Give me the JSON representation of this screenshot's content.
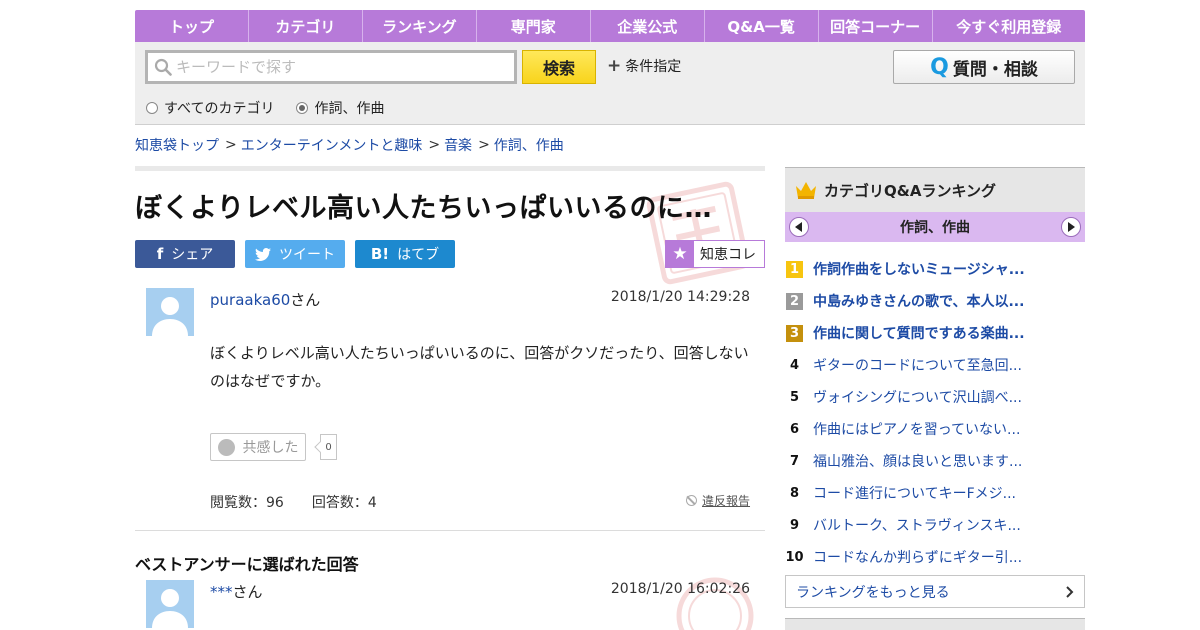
{
  "nav": {
    "items": [
      "トップ",
      "カテゴリ",
      "ランキング",
      "専門家",
      "企業公式",
      "Q&A一覧",
      "回答コーナー",
      "今すぐ利用登録"
    ]
  },
  "search": {
    "placeholder": "キーワードで探す",
    "button": "検索",
    "condition": "条件指定",
    "ask_button": "質問・相談",
    "ask_q": "Q",
    "radio_all": "すべてのカテゴリ",
    "radio_current": "作詞、作曲"
  },
  "breadcrumb": {
    "items": [
      "知恵袋トップ",
      "エンターテインメントと趣味",
      "音楽",
      "作詞、作曲"
    ],
    "sep": ">"
  },
  "question": {
    "title": "ぼくよりレベル高い人たちいっぱいいるのに…",
    "share": {
      "facebook": "シェア",
      "twitter": "ツイート",
      "hatena": "はてブ",
      "hatena_icon": "B!"
    },
    "chiekore": "知恵コレ",
    "user": "puraaka60",
    "user_suffix": "さん",
    "date": "2018/1/20  14:29:28",
    "body": "ぼくよりレベル高い人たちいっぱいいるのに、回答がクソだったり、回答しないのはなぜですか。",
    "empathy_label": "共感した",
    "empathy_count": "0",
    "views": "閲覧数：96",
    "answers": "回答数：4",
    "report": "違反報告"
  },
  "best_answer": {
    "heading": "ベストアンサーに選ばれた回答",
    "user": "***",
    "user_suffix": "さん",
    "date": "2018/1/20  16:02:26"
  },
  "sidebar": {
    "title": "カテゴリQ&Aランキング",
    "category": "作詞、作曲",
    "ranking": [
      {
        "rank": "1",
        "text": "作詞作曲をしないミュージシャ..."
      },
      {
        "rank": "2",
        "text": "中島みゆきさんの歌で、本人以..."
      },
      {
        "rank": "3",
        "text": "作曲に関して質問ですある楽曲..."
      },
      {
        "rank": "4",
        "text": "ギターのコードについて至急回..."
      },
      {
        "rank": "5",
        "text": "ヴォイシングについて沢山調べ..."
      },
      {
        "rank": "6",
        "text": "作曲にはピアノを習っていない..."
      },
      {
        "rank": "7",
        "text": "福山雅治、顔は良いと思います..."
      },
      {
        "rank": "8",
        "text": "コード進行についてキーFメジ..."
      },
      {
        "rank": "9",
        "text": "バルトーク、ストラヴィンスキ..."
      },
      {
        "rank": "10",
        "text": "コードなんか判らずにギター引..."
      }
    ],
    "more": "ランキングをもっと見る"
  },
  "colors": {
    "nav_bg": "#b77ad9",
    "link": "#1d4ba5",
    "search_btn": "#f8d41c",
    "facebook": "#3b5998",
    "twitter": "#55acee",
    "hatena": "#1d89cf"
  }
}
